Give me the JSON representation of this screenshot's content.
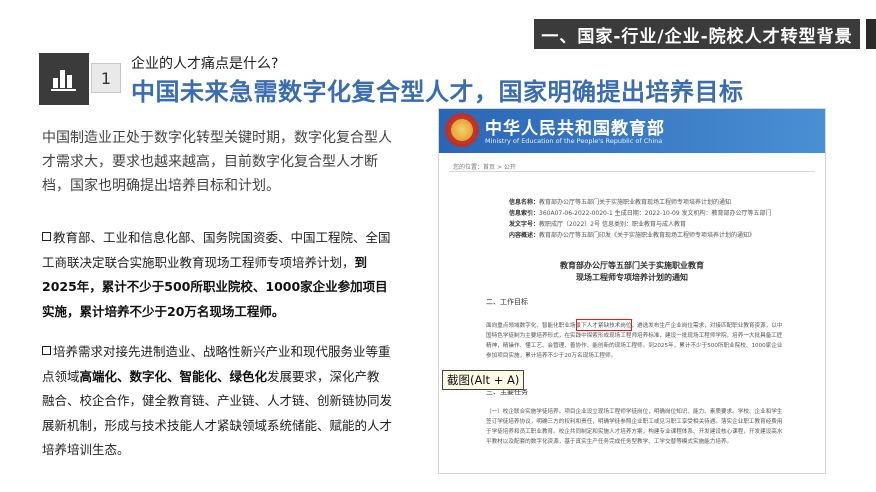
{
  "section_banner": "一、国家-行业/企业-院校人才转型背景",
  "slide_number": "1",
  "sub_question": "企业的人才痛点是什么?",
  "headline": "中国未来急需数字化复合型人才，国家明确提出培养目标",
  "intro_paragraph": "中国制造业正处于数字化转型关键时期，数字化复合型人才需求大，要求也越来越高，目前数字化复合型人才断档，国家也明确提出培养目标和计划。",
  "bullet1": {
    "normal": "教育部、工业和信息化部、国务院国资委、中国工程院、全国工商联决定联合实施职业教育现场工程师专项培养计划，",
    "bold": "到2025年，累计不少于500所职业院校、1000家企业参加项目实施，累计培养不少于20万名现场工程师。"
  },
  "bullet2": {
    "part1": "培养需求对接先进制造业、战略性新兴产业和现代服务业等重点领域",
    "bold1": "高端化、数字化、智能化、绿色化",
    "part2": "发展要求，深化产教融合、校企合作，健全教育链、产业链、人才链、创新链协同发展新机制，形成与技术技能人才紧缺领域系统储能、赋能的人才培养培训生态。"
  },
  "screenshot": {
    "ministry_cn": "中华人民共和国教育部",
    "ministry_en": "Ministry of Education of the People's Republic of China",
    "breadcrumb": "您的位置：首页 > 公开",
    "meta": [
      {
        "label": "信息名称：",
        "value": "教育部办公厅等五部门关于实施职业教育现场工程师专项培养计划的通知"
      },
      {
        "label": "信息索引：",
        "value": "360A07-06-2022-0020-1   生成日期：2022-10-09   发文机构：教育部办公厅等五部门"
      },
      {
        "label": "发文字号：",
        "value": "教职成厅〔2022〕2号   信息类别：职业教育与成人教育"
      },
      {
        "label": "内容概述：",
        "value": "教育部办公厅等五部门印发《关于实施职业教育现场工程师专项培养计划的通知》"
      }
    ],
    "doc_title_1": "教育部办公厅等五部门关于实施职业教育",
    "doc_title_2": "现场工程师专项培养计划的通知",
    "section_1": "二、工作目标",
    "body_1": "面向重点领域数字化、智能化职业场景下人才紧缺技术岗位，遴选发布生产企业岗位需求，对接匹配职业教育资源，以中国特色学徒制为主要培养形式，在实践中探索形成现场工程师培养标准，建设一批现场工程师学院，培养一大批具备工匠精神，精操作、懂工艺、会管理、善协作、能创新的现场工程师。到2025年，累计不少于500所职业院校、1000家企业参加项目实施，累计培养不少于20万名现场工程师。",
    "section_2": "三、主要任务",
    "body_2": "（一）校企联合实施学徒培养。项目企业设立现场工程师学徒岗位，明确岗位知识、能力、素质要求。学校、企业和学生签订学徒培养协议，明确三方的权利和责任，明确学徒参照企业职工或见习职工享受相关待遇。落实企业职工教育经费用于学徒培养和员工职业教育。校企共同制定和实施人才培养方案，构建专业课程体系、开发建设核心课程，开发建设高水平教材以及配套的数字化资源，基于真实生产任务完成任务型教学、工学交替等模式实施能力培养。"
  },
  "tooltip": "截图(Alt + A)"
}
